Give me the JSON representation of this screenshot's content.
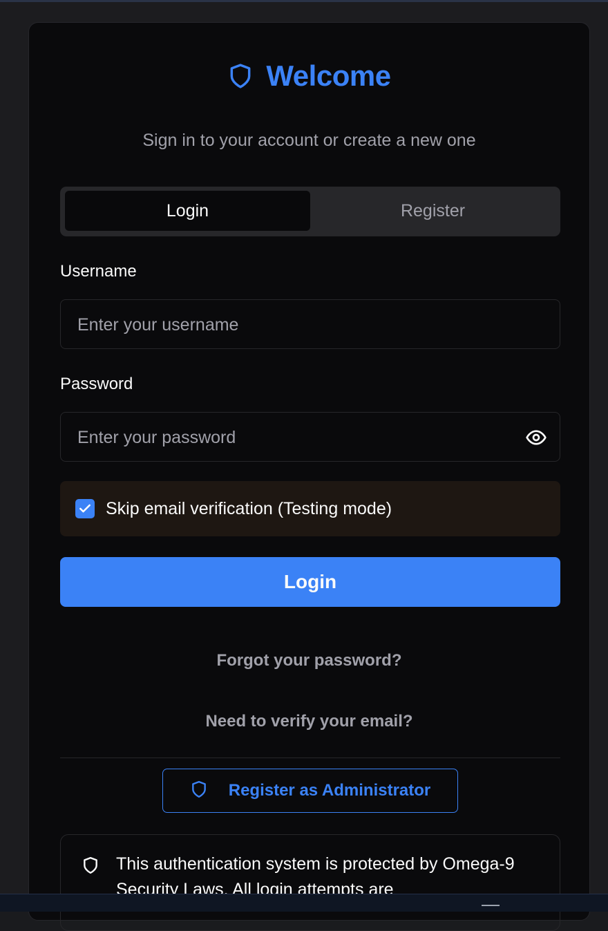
{
  "header": {
    "title": "Welcome",
    "subtitle": "Sign in to your account or create a new one",
    "icon": "shield-icon"
  },
  "tabs": [
    {
      "label": "Login",
      "active": true
    },
    {
      "label": "Register",
      "active": false
    }
  ],
  "form": {
    "username_label": "Username",
    "username_placeholder": "Enter your username",
    "username_value": "",
    "password_label": "Password",
    "password_placeholder": "Enter your password",
    "password_value": "",
    "password_toggle_icon": "eye-icon",
    "skip_verification_label": "Skip email verification (Testing mode)",
    "skip_verification_checked": true,
    "submit_label": "Login"
  },
  "links": {
    "forgot_password": "Forgot your password?",
    "verify_email": "Need to verify your email?"
  },
  "admin": {
    "label": "Register as Administrator",
    "icon": "shield-icon"
  },
  "notice": {
    "icon": "shield-icon",
    "text": "This authentication system is protected by Omega-9 Security Laws. All login attempts are"
  },
  "colors": {
    "accent": "#3b82f6",
    "background": "#0a0a0c",
    "muted_text": "#a1a1aa",
    "warning_bg": "#1e1712"
  }
}
